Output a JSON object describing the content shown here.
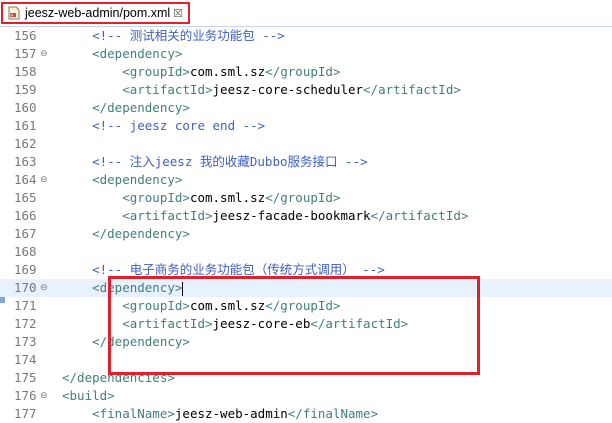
{
  "tab": {
    "title": "jeesz-web-admin/pom.xml",
    "close_symbol": "☒",
    "icon": "xml-file-icon"
  },
  "editor": {
    "lines": [
      {
        "num": "156",
        "fold": "",
        "parts": [
          [
            "comment",
            "    <!-- 测试相关的业务功能包 -->"
          ]
        ]
      },
      {
        "num": "157",
        "fold": "⊖",
        "parts": [
          [
            "tag",
            "    <dependency>"
          ]
        ]
      },
      {
        "num": "158",
        "fold": "",
        "parts": [
          [
            "tag",
            "        <groupId>"
          ],
          [
            "text",
            "com.sml.sz"
          ],
          [
            "tag",
            "</groupId>"
          ]
        ]
      },
      {
        "num": "159",
        "fold": "",
        "parts": [
          [
            "tag",
            "        <artifactId>"
          ],
          [
            "text",
            "jeesz-core-scheduler"
          ],
          [
            "tag",
            "</artifactId>"
          ]
        ]
      },
      {
        "num": "160",
        "fold": "",
        "parts": [
          [
            "tag",
            "    </dependency>"
          ]
        ]
      },
      {
        "num": "161",
        "fold": "",
        "parts": [
          [
            "comment",
            "    <!-- jeesz core end -->"
          ]
        ]
      },
      {
        "num": "162",
        "fold": "",
        "parts": [
          [
            "text",
            ""
          ]
        ]
      },
      {
        "num": "163",
        "fold": "",
        "parts": [
          [
            "comment",
            "    <!-- 注入jeesz 我的收藏Dubbo服务接口 -->"
          ]
        ]
      },
      {
        "num": "164",
        "fold": "⊖",
        "parts": [
          [
            "tag",
            "    <dependency>"
          ]
        ]
      },
      {
        "num": "165",
        "fold": "",
        "parts": [
          [
            "tag",
            "        <groupId>"
          ],
          [
            "text",
            "com.sml.sz"
          ],
          [
            "tag",
            "</groupId>"
          ]
        ]
      },
      {
        "num": "166",
        "fold": "",
        "parts": [
          [
            "tag",
            "        <artifactId>"
          ],
          [
            "text",
            "jeesz-facade-bookmark"
          ],
          [
            "tag",
            "</artifactId>"
          ]
        ]
      },
      {
        "num": "167",
        "fold": "",
        "parts": [
          [
            "tag",
            "    </dependency>"
          ]
        ]
      },
      {
        "num": "168",
        "fold": "",
        "parts": [
          [
            "text",
            ""
          ]
        ]
      },
      {
        "num": "169",
        "fold": "",
        "parts": [
          [
            "comment",
            "    <!-- 电子商务的业务功能包（传统方式调用） -->"
          ]
        ]
      },
      {
        "num": "170",
        "fold": "⊖",
        "parts": [
          [
            "tag",
            "    <dependency>"
          ]
        ],
        "current": true
      },
      {
        "num": "171",
        "fold": "",
        "parts": [
          [
            "tag",
            "        <groupId>"
          ],
          [
            "text",
            "com.sml.sz"
          ],
          [
            "tag",
            "</groupId>"
          ]
        ]
      },
      {
        "num": "172",
        "fold": "",
        "parts": [
          [
            "tag",
            "        <artifactId>"
          ],
          [
            "text",
            "jeesz-core-eb"
          ],
          [
            "tag",
            "</artifactId>"
          ]
        ]
      },
      {
        "num": "173",
        "fold": "",
        "parts": [
          [
            "tag",
            "    </dependency>"
          ]
        ]
      },
      {
        "num": "174",
        "fold": "",
        "parts": [
          [
            "text",
            ""
          ]
        ]
      },
      {
        "num": "175",
        "fold": "",
        "parts": [
          [
            "tag",
            "</dependencies>"
          ]
        ]
      },
      {
        "num": "176",
        "fold": "⊖",
        "parts": [
          [
            "tag",
            "<build>"
          ]
        ]
      },
      {
        "num": "177",
        "fold": "",
        "parts": [
          [
            "tag",
            "    <finalName>"
          ],
          [
            "text",
            "jeesz-web-admin"
          ],
          [
            "tag",
            "</finalName>"
          ]
        ]
      }
    ]
  },
  "colors": {
    "highlight_border": "#e0202a",
    "comment": "#3f5fbf",
    "tag": "#3f7f7f",
    "line_number": "#787878"
  }
}
